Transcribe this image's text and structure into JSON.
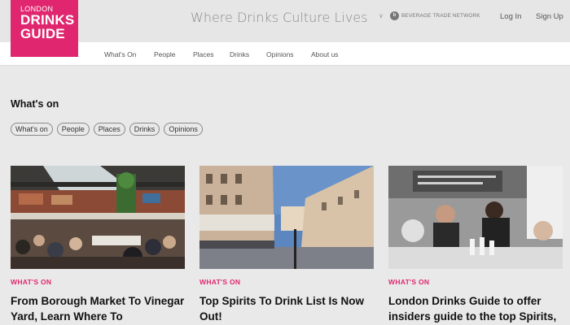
{
  "logo": {
    "line1": "LONDON",
    "line2": "DRINKS",
    "line3": "GUIDE"
  },
  "header": {
    "tagline": "Where Drinks Culture Lives",
    "network": "BEVERAGE TRADE NETWORK",
    "login": "Log In",
    "signup": "Sign Up"
  },
  "nav": [
    "What's On",
    "People",
    "Places",
    "Drinks",
    "Opinions",
    "About us"
  ],
  "section": {
    "title": "What's on",
    "chips": [
      "What's on",
      "People",
      "Places",
      "Drinks",
      "Opinions"
    ]
  },
  "cards": [
    {
      "category": "WHAT'S ON",
      "title": "From Borough Market To Vinegar Yard, Learn Where To"
    },
    {
      "category": "WHAT'S ON",
      "title": "Top Spirits To Drink List Is Now Out!"
    },
    {
      "category": "WHAT'S ON",
      "title": "London Drinks Guide to offer insiders guide to the top Spirits,"
    }
  ],
  "colors": {
    "brand": "#e0266e",
    "background": "#e9e9e9"
  }
}
